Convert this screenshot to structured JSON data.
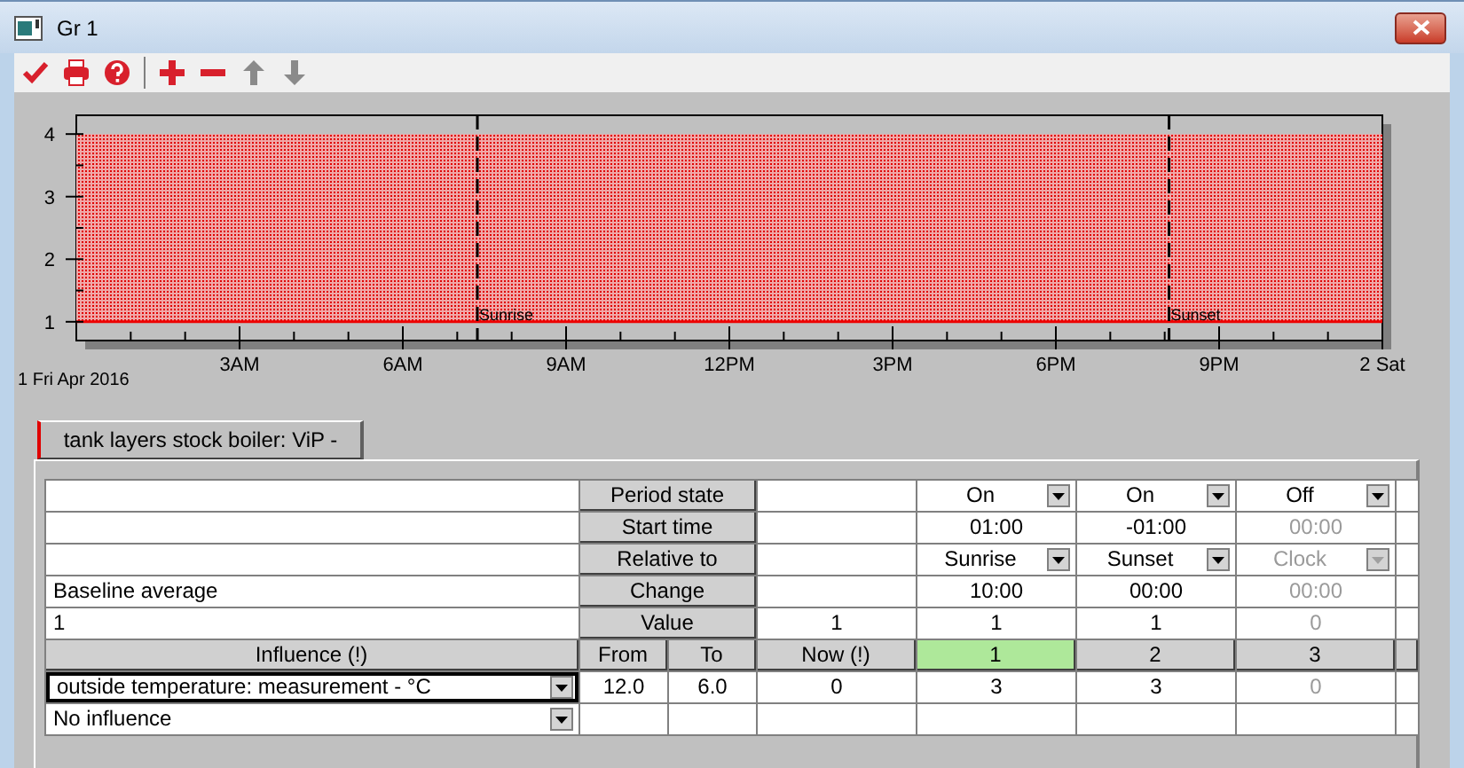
{
  "window": {
    "title": "Gr 1"
  },
  "toolbar": [
    {
      "kind": "check",
      "disabled": false
    },
    {
      "kind": "print",
      "disabled": false
    },
    {
      "kind": "help",
      "disabled": false
    },
    {
      "kind": "separator"
    },
    {
      "kind": "add",
      "disabled": false
    },
    {
      "kind": "remove",
      "disabled": false
    },
    {
      "kind": "up",
      "disabled": true
    },
    {
      "kind": "down",
      "disabled": true
    }
  ],
  "chart": {
    "date_label": "1 Fri Apr 2016",
    "y_labels": [
      "4",
      "3",
      "2",
      "1"
    ],
    "x_labels": [
      "3AM",
      "6AM",
      "9AM",
      "12PM",
      "3PM",
      "6PM",
      "9PM",
      "2 Sat"
    ],
    "markers": [
      {
        "label": "Sunrise"
      },
      {
        "label": "Sunset"
      }
    ]
  },
  "tabs": [
    {
      "label": "tank layers stock boiler: ViP -",
      "selected": true
    }
  ],
  "table": {
    "rows": [
      {
        "header": "Period state",
        "kind": "dropdown",
        "periods": [
          {
            "value": "On",
            "disabled": false
          },
          {
            "value": "On",
            "disabled": false
          },
          {
            "value": "Off",
            "disabled": false
          }
        ]
      },
      {
        "header": "Start time",
        "kind": "text",
        "periods": [
          {
            "value": "01:00",
            "disabled": false
          },
          {
            "value": "-01:00",
            "disabled": false
          },
          {
            "value": "00:00",
            "disabled": true
          }
        ]
      },
      {
        "header": "Relative to",
        "kind": "dropdown",
        "periods": [
          {
            "value": "Sunrise",
            "disabled": false
          },
          {
            "value": "Sunset",
            "disabled": false
          },
          {
            "value": "Clock",
            "disabled": true
          }
        ]
      },
      {
        "note": "Baseline average",
        "header": "Change",
        "kind": "text",
        "periods": [
          {
            "value": "10:00",
            "disabled": false
          },
          {
            "value": "00:00",
            "disabled": false
          },
          {
            "value": "00:00",
            "disabled": true
          }
        ]
      },
      {
        "note": "1",
        "header": "Value",
        "now": "1",
        "kind": "text",
        "periods": [
          {
            "value": "1",
            "disabled": false
          },
          {
            "value": "1",
            "disabled": false
          },
          {
            "value": "0",
            "disabled": true
          }
        ]
      }
    ],
    "influence_header": {
      "label": "Influence (!)",
      "from": "From",
      "to": "To",
      "now": "Now (!)",
      "periods": [
        {
          "label": "1",
          "selected": true
        },
        {
          "label": "2",
          "selected": false
        },
        {
          "label": "3",
          "selected": false
        }
      ]
    },
    "influences": [
      {
        "source": "outside temperature: measurement - °C",
        "focused": true,
        "from": "12.0",
        "to": "6.0",
        "now": "0",
        "periods": [
          {
            "value": "3",
            "disabled": false
          },
          {
            "value": "3",
            "disabled": false
          },
          {
            "value": "0",
            "disabled": true
          }
        ]
      },
      {
        "source": "No influence",
        "focused": false
      }
    ]
  }
}
